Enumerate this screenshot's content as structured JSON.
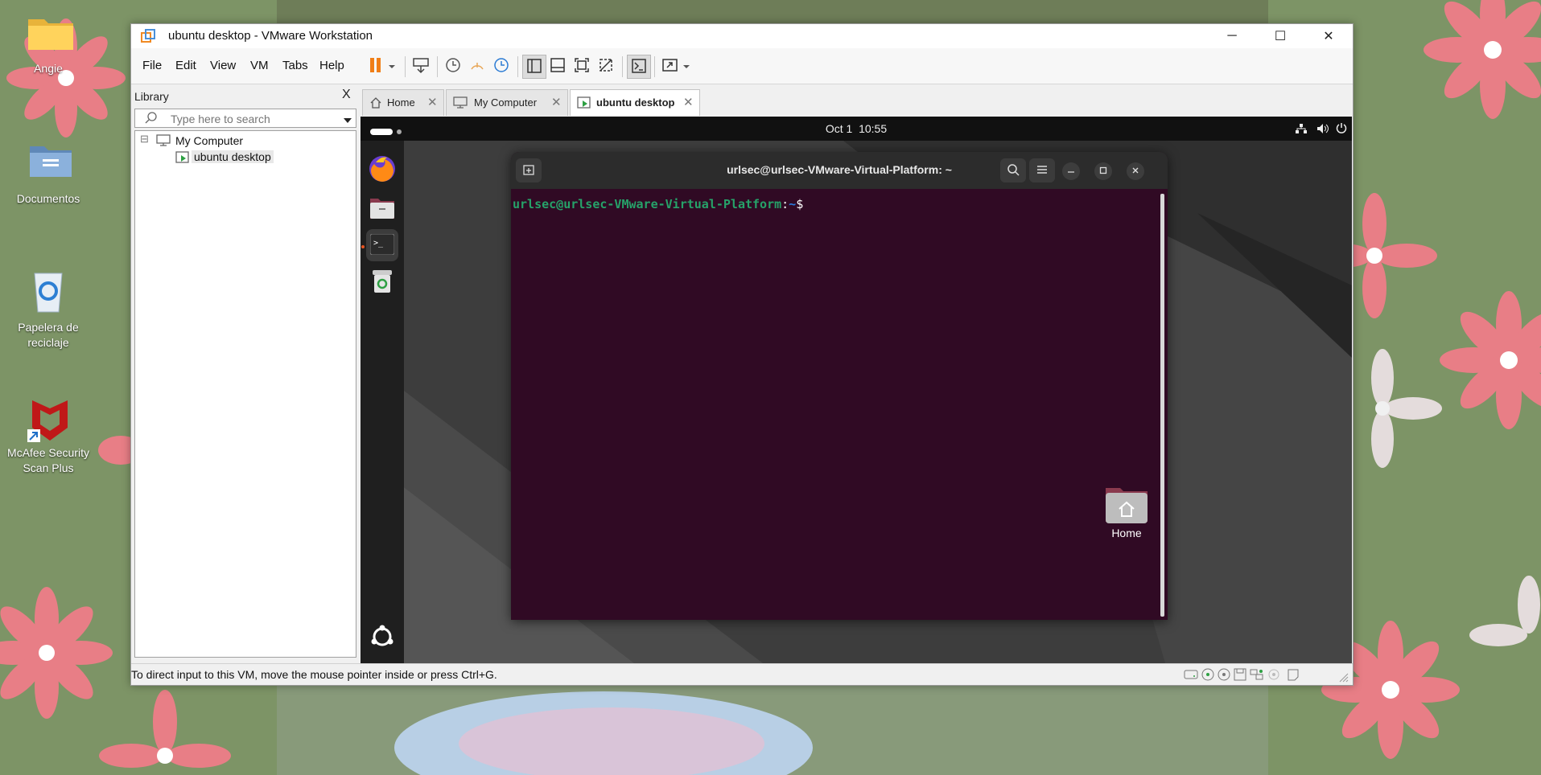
{
  "desktop": {
    "icons": [
      {
        "label": "Angie",
        "icon": "folder-icon"
      },
      {
        "label": "Documentos",
        "icon": "documents-folder-icon"
      },
      {
        "label": "Papelera de reciclaje",
        "icon": "recycle-bin-icon"
      },
      {
        "label": "McAfee Security Scan Plus",
        "icon": "mcafee-icon"
      }
    ]
  },
  "window": {
    "title": "ubuntu desktop - VMware Workstation",
    "controls": {
      "minimize": "─",
      "maximize": "☐",
      "close": "✕"
    }
  },
  "menu": [
    "File",
    "Edit",
    "View",
    "VM",
    "Tabs",
    "Help"
  ],
  "library": {
    "title": "Library",
    "close": "X",
    "search_placeholder": "Type here to search",
    "tree": {
      "root": "My Computer",
      "child": "ubuntu desktop",
      "collapse": "⊟"
    }
  },
  "tabs": [
    {
      "label": "Home",
      "active": false
    },
    {
      "label": "My Computer",
      "active": false
    },
    {
      "label": "ubuntu desktop",
      "active": true
    }
  ],
  "ubuntu": {
    "clock": "Oct 1  10:55",
    "terminal": {
      "title": "urlsec@urlsec-VMware-Virtual-Platform: ~",
      "prompt_user": "urlsec@urlsec-VMware-Virtual-Platform",
      "prompt_sep": ":",
      "prompt_path": "~",
      "prompt_symbol": "$"
    },
    "desktop_home_label": "Home"
  },
  "statusbar": {
    "text": "To direct input to this VM, move the mouse pointer inside or press Ctrl+G."
  },
  "colors": {
    "wallpaper_green": "#7d9466",
    "flower_pink": "#e87e86",
    "terminal_bg": "#300a24",
    "prompt_green": "#26a269",
    "pause_orange": "#f07e17"
  }
}
